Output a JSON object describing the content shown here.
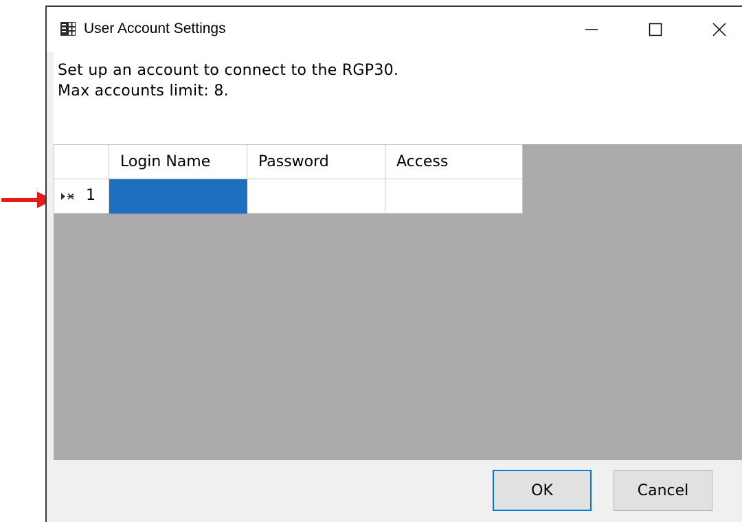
{
  "annotation": {
    "arrow_color": "#e31b1b",
    "points_to": "row-header-1"
  },
  "window": {
    "title": "User Account Settings",
    "icon": "table-settings-icon",
    "controls": {
      "minimize_icon": "minimize-icon",
      "maximize_icon": "maximize-icon",
      "close_icon": "close-icon"
    }
  },
  "info": {
    "line1": "Set up an account to connect to the RGP30.",
    "line2": "Max accounts limit: 8."
  },
  "grid": {
    "columns": [
      "Login Name",
      "Password",
      "Access"
    ],
    "rows": [
      {
        "header_glyph": "new-row-icon",
        "number": "1",
        "cells": [
          "",
          "",
          ""
        ],
        "selected_cell": 0
      }
    ],
    "selection_color": "#1e6fbf",
    "background_color": "#ababab"
  },
  "buttons": {
    "ok": "OK",
    "cancel": "Cancel",
    "default_border_color": "#0078d7"
  }
}
